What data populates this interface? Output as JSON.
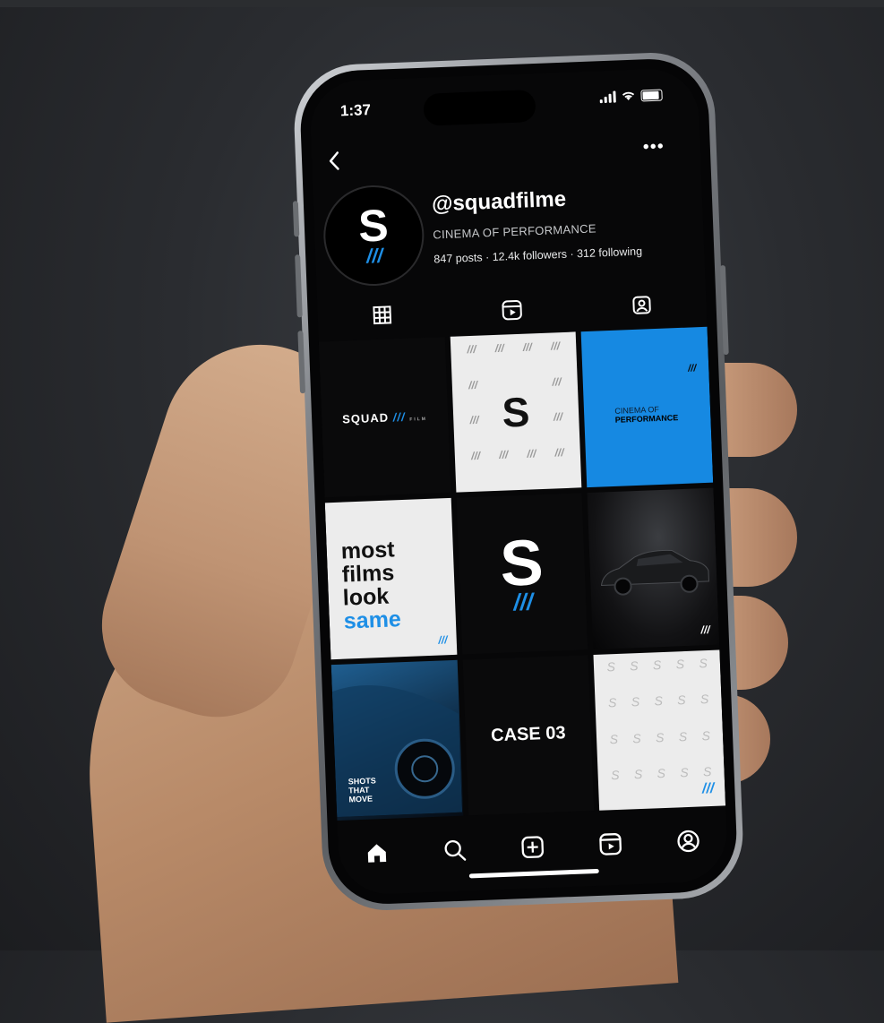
{
  "status_bar": {
    "time": "1:37"
  },
  "profile": {
    "handle": "@squadfilme",
    "tagline": "CINEMA OF PERFORMANCE",
    "stats": "847 posts · 12.4k followers · 312 following",
    "avatar_letter": "S",
    "avatar_stripes": "///"
  },
  "grid": {
    "post1": {
      "brand": "SQUAD",
      "stripes": "///",
      "sub": "FILM"
    },
    "post2": {
      "letter": "S",
      "pattern_mark": "///"
    },
    "post3": {
      "line1": "CINEMA OF",
      "line2": "PERFORMANCE",
      "stripes": "///"
    },
    "post4": {
      "w1": "most",
      "w2": "films",
      "w3": "look",
      "w4": "same",
      "stripes": "///"
    },
    "post5": {
      "letter": "S",
      "stripes": "///"
    },
    "post6": {
      "stripes": "///"
    },
    "post7": {
      "l1": "SHOTS",
      "l2": "THAT",
      "l3": "MOVE"
    },
    "post8": {
      "text": "CASE 03"
    },
    "post9": {
      "stripes": "///",
      "pattern_mark": "S"
    }
  },
  "colors": {
    "accent": "#1e8fe6",
    "screen_bg": "#070708"
  },
  "icons": {
    "tabs": [
      "grid-icon",
      "reels-icon",
      "tagged-icon"
    ],
    "nav": [
      "home-icon",
      "search-icon",
      "create-icon",
      "reels-icon",
      "profile-icon"
    ]
  }
}
